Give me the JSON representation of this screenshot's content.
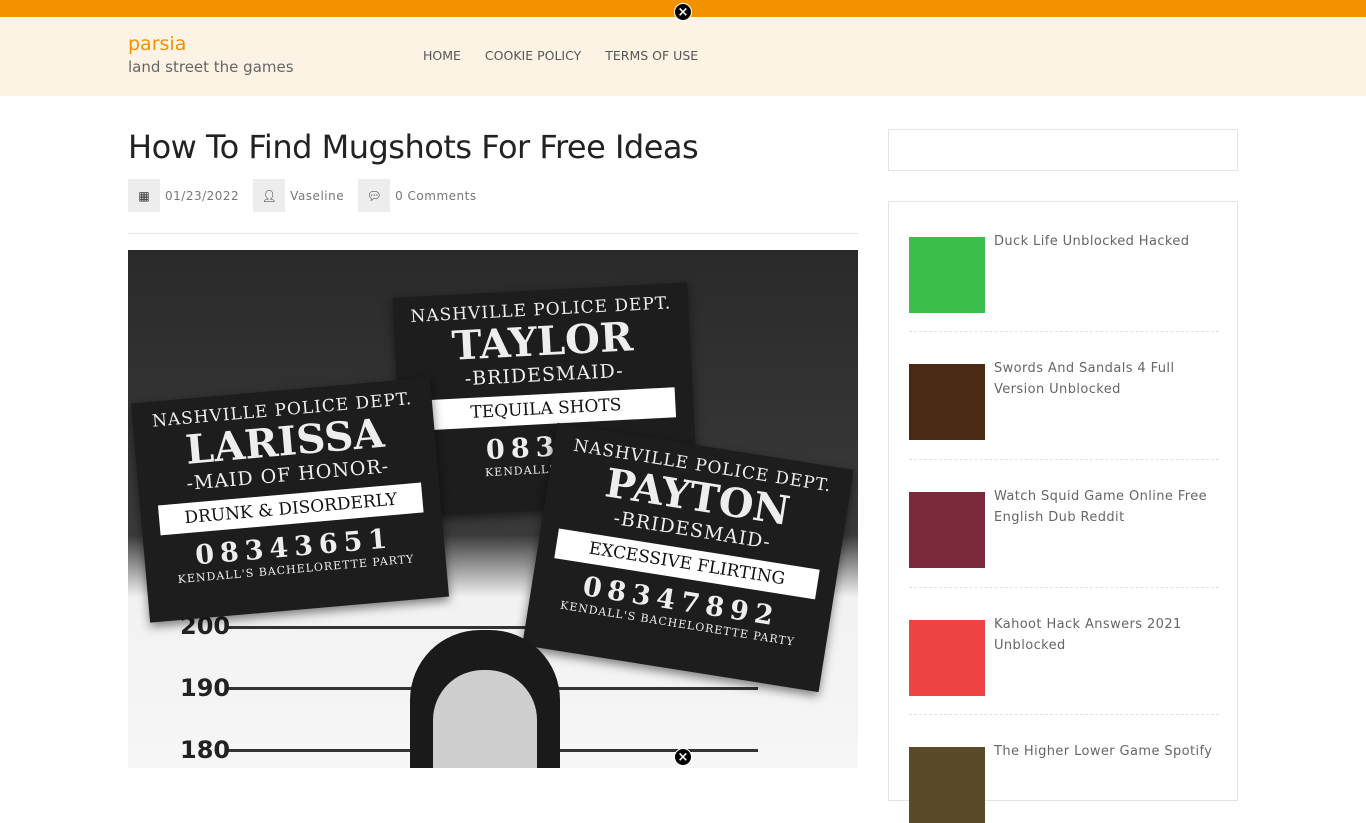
{
  "site": {
    "name": "parsia",
    "tagline": "land street the games"
  },
  "nav": [
    "HOME",
    "COOKIE POLICY",
    "TERMS OF USE"
  ],
  "article": {
    "title": "How To Find Mugshots For Free Ideas",
    "date": "01/23/2022",
    "author": "Vaseline",
    "comments": "0 Comments"
  },
  "hero": {
    "cards": [
      {
        "dept": "NASHVILLE POLICE DEPT.",
        "name": "LARISSA",
        "role": "-MAID OF HONOR-",
        "charge": "DRUNK & DISORDERLY",
        "number": "08343651",
        "party": "KENDALL'S BACHELORETTE PARTY"
      },
      {
        "dept": "NASHVILLE POLICE DEPT.",
        "name": "TAYLOR",
        "role": "-BRIDESMAID-",
        "charge": "TEQUILA SHOTS",
        "number": "08367",
        "party": "KENDALL'S BACHE"
      },
      {
        "dept": "NASHVILLE POLICE DEPT.",
        "name": "PAYTON",
        "role": "-BRIDESMAID-",
        "charge": "EXCESSIVE FLIRTING",
        "number": "08347892",
        "party": "KENDALL'S BACHELORETTE PARTY"
      }
    ],
    "heights": [
      "200",
      "190",
      "180"
    ]
  },
  "sidebar": {
    "posts": [
      {
        "title": "Duck Life Unblocked Hacked",
        "thumb_color": "#3cbf4a"
      },
      {
        "title": "Swords And Sandals 4 Full Version Unblocked",
        "thumb_color": "#4a2a12"
      },
      {
        "title": "Watch Squid Game Online Free English Dub Reddit",
        "thumb_color": "#7a2a3a"
      },
      {
        "title": "Kahoot Hack Answers 2021 Unblocked",
        "thumb_color": "#ee4444"
      },
      {
        "title": "The Higher Lower Game Spotify",
        "thumb_color": "#5a4a2a"
      }
    ]
  },
  "close_icon": "×"
}
